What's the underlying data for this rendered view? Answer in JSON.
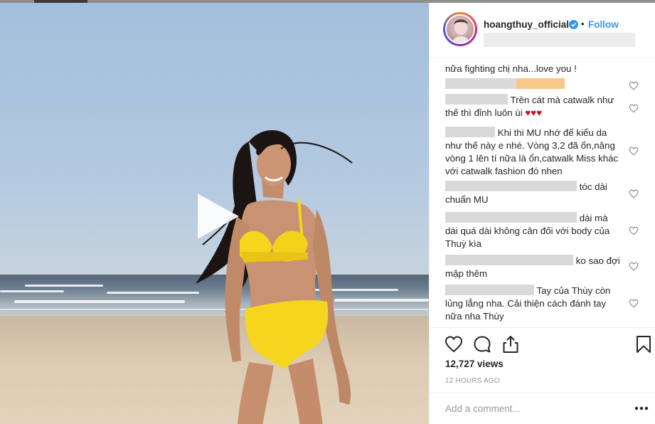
{
  "post": {
    "username": "hoangthuy_official",
    "separator": "•",
    "follow_label": "Follow",
    "views": "12,727 views",
    "timestamp": "12 HOURS AGO",
    "add_comment_placeholder": "Add a comment..."
  },
  "comments": [
    {
      "text": "nữa fighting chị nha...love you !"
    },
    {
      "text": ""
    },
    {
      "text": "Trên cát mà catwalk như thế thì đỉnh luôn ùi ♥♥♥"
    },
    {
      "text": "Khi thi MU nhớ để kiểu da như thế này e nhé. Vòng 3,2 đã ổn,nâng vòng 1 lên tí nữa là ổn,catwalk Miss khác với catwalk fashion đó nhen"
    },
    {
      "text": "tóc dài chuẩn MU"
    },
    {
      "text": "dài mà dài quá dài không cân đối với body của Thuỳ kìa"
    },
    {
      "text": "ko sao đợi mập thêm"
    },
    {
      "text": "Tay của Thùy còn lủng lẳng nha. Cải thiện cách đánh tay nữa nha Thùy"
    }
  ],
  "icons": {
    "play": "play-icon",
    "verified": "verified-badge-icon",
    "like": "heart-icon",
    "comment": "comment-icon",
    "share": "share-icon",
    "save": "bookmark-icon",
    "more": "more-options-icon"
  },
  "colors": {
    "link": "#3897f0",
    "text": "#262626",
    "muted": "#999999",
    "bikini": "#f5d51e",
    "heart_emoji": "#c1121f"
  }
}
